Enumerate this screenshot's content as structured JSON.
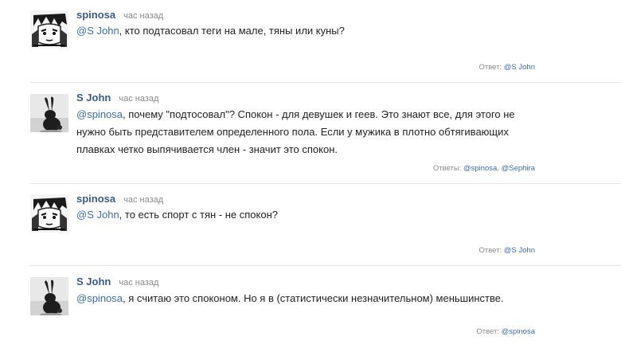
{
  "comments": [
    {
      "author": "spinosa",
      "time": "час назад",
      "mention": "@S John",
      "text": ", кто подтасовал теги на мале, тяны или куны?",
      "replies_label": "Ответ:",
      "replies": [
        "@S John"
      ],
      "avatar": "manga-avatar-icon"
    },
    {
      "author": "S John",
      "time": "час назад",
      "mention": "@spinosa",
      "text": ", почему \"подтосовал\"? Спокон - для девушек и геев. Это знают все, для этого не нужно быть представителем определенного пола. Если у мужика в плотно обтягивающих плавках четко выпячивается член - значит это спокон.",
      "replies_label": "Ответы:",
      "replies": [
        "@spinosa",
        "@Sephira"
      ],
      "avatar": "rabbit-avatar-icon"
    },
    {
      "author": "spinosa",
      "time": "час назад",
      "mention": "@S John",
      "text": ", то есть спорт с тян - не спокон?",
      "replies_label": "Ответ:",
      "replies": [
        "@S John"
      ],
      "avatar": "manga-avatar-icon"
    },
    {
      "author": "S John",
      "time": "час назад",
      "mention": "@spinosa",
      "text": ", я считаю это споконом. Но я в (статистически незначительном) меньшинстве.",
      "replies_label": "Ответ:",
      "replies": [
        "@spinosa"
      ],
      "avatar": "rabbit-avatar-icon"
    }
  ]
}
